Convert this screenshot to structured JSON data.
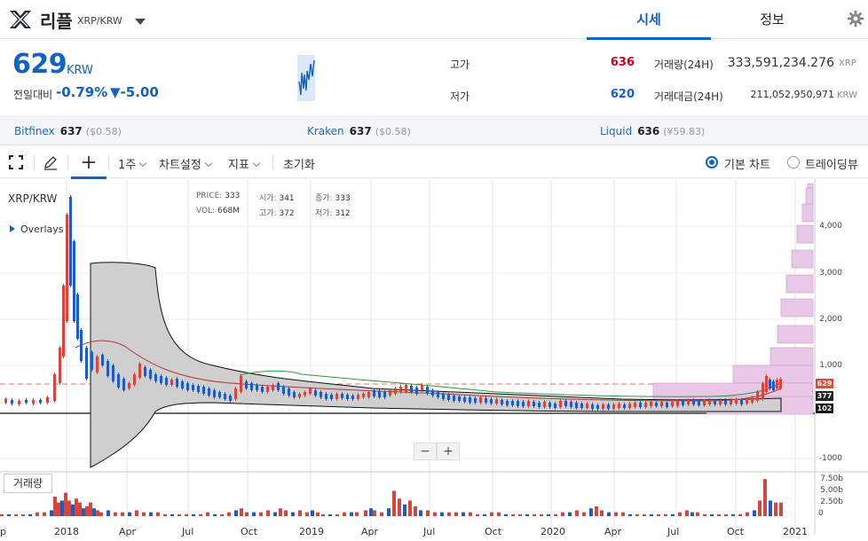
{
  "header": {
    "coin_name": "리플",
    "pair": "XRP/KRW",
    "tabs": [
      {
        "label": "시세",
        "active": true
      },
      {
        "label": "정보",
        "active": false
      }
    ]
  },
  "price": {
    "current": "629",
    "unit": "KRW",
    "change_label": "전일대비",
    "change_rate": "-0.79%",
    "change_abs": "▼-5.00",
    "color": "#1261c4"
  },
  "stats": {
    "high_label": "고가",
    "high_value": "636",
    "high_color": "#d0021b",
    "low_label": "저가",
    "low_value": "620",
    "low_color": "#1261c4",
    "volume_label": "거래량(24H)",
    "volume_value": "333,591,234.276",
    "volume_unit": "XRP",
    "amount_label": "거래대금(24H)",
    "amount_value": "211,052,950,971",
    "amount_unit": "KRW"
  },
  "exchanges": [
    {
      "name": "Bitfinex",
      "price": "637",
      "sub": "($0.58)"
    },
    {
      "name": "Kraken",
      "price": "637",
      "sub": "($0.58)"
    },
    {
      "name": "Liquid",
      "price": "636",
      "sub": "(¥59.83)"
    }
  ],
  "toolbar": {
    "interval": "1주",
    "chart_settings": "차트설정",
    "indicators": "지표",
    "reset": "초기화",
    "mode_basic": "기본 차트",
    "mode_tradingview": "트레이딩뷰"
  },
  "chart": {
    "pair_label": "XRP/KRW",
    "overlays_label": "Overlays",
    "ohlc": {
      "price_label": "PRICE:",
      "price": "333",
      "open_label": "시가:",
      "open": "341",
      "close_label": "종가:",
      "close": "333",
      "vol_label": "VOL:",
      "vol": "668M",
      "high_label": "고가:",
      "high": "372",
      "low_label": "저가:",
      "low": "312"
    },
    "zoom_out": "−",
    "zoom_in": "+",
    "volume_label": "거래량",
    "y_ticks": [
      "4,000",
      "3,000",
      "2,000",
      "1,000",
      "-1000"
    ],
    "volume_ticks": [
      "7.50b",
      "5.00b",
      "2.50b",
      "0"
    ],
    "x_ticks": [
      "p",
      "2018",
      "Apr",
      "Jul",
      "Oct",
      "2019",
      "Apr",
      "Jul",
      "Oct",
      "2020",
      "Apr",
      "Jul",
      "Oct",
      "2021"
    ],
    "price_flags": [
      {
        "value": "629",
        "color": "#e04a3a"
      },
      {
        "value": "377",
        "color": "#222222"
      },
      {
        "value": "102",
        "color": "#111111"
      }
    ],
    "up_color": "#d8453b",
    "down_color": "#1a5cc8"
  }
}
